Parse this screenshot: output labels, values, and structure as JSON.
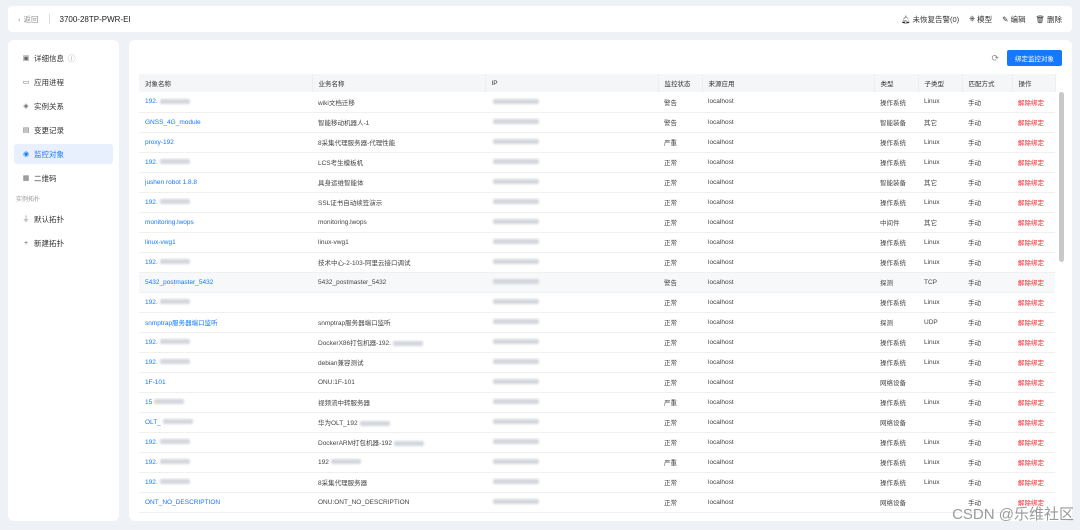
{
  "topbar": {
    "back": "返回",
    "title": "3700-28TP-PWR-EI",
    "actions": {
      "alarm": "未恢复告警(0)",
      "model": "模型",
      "edit": "编辑",
      "delete": "删除"
    }
  },
  "sidebar": {
    "items": [
      {
        "label": "详细信息",
        "icon": "info-icon"
      },
      {
        "label": "应用进程",
        "icon": "process-icon"
      },
      {
        "label": "实例关系",
        "icon": "relation-icon"
      },
      {
        "label": "变更记录",
        "icon": "record-icon"
      },
      {
        "label": "监控对象",
        "icon": "monitor-icon"
      },
      {
        "label": "二维码",
        "icon": "qrcode-icon"
      }
    ],
    "group_label": "实例拓扑",
    "topo": [
      {
        "label": "默认拓扑",
        "icon": "topology-icon"
      },
      {
        "label": "新建拓扑",
        "icon": "plus-icon"
      }
    ],
    "active_index": 4
  },
  "toolbar": {
    "bind_button": "绑定监控对象"
  },
  "table": {
    "headers": [
      "对象名称",
      "业务名称",
      "IP",
      "监控状态",
      "来源应用",
      "类型",
      "子类型",
      "匹配方式",
      "操作"
    ],
    "rows": [
      {
        "name": "192.",
        "business": "wiki文档迁移",
        "ip": "",
        "status": "警告",
        "source": "localhost",
        "type": "操作系统",
        "subtype": "Linux",
        "match": "手动",
        "op": "解除绑定"
      },
      {
        "name": "GNSS_4G_module",
        "business": "智能移动机器人-1",
        "ip": "",
        "status": "警告",
        "source": "localhost",
        "type": "智能装备",
        "subtype": "其它",
        "match": "手动",
        "op": "解除绑定"
      },
      {
        "name": "proxy-192",
        "business": "8采集代理服务器-代理性能",
        "ip": "",
        "status": "严重",
        "source": "localhost",
        "type": "操作系统",
        "subtype": "Linux",
        "match": "手动",
        "op": "解除绑定"
      },
      {
        "name": "192.",
        "business": "LCS考生模板机",
        "ip": "",
        "status": "正常",
        "source": "localhost",
        "type": "操作系统",
        "subtype": "Linux",
        "match": "手动",
        "op": "解除绑定"
      },
      {
        "name": "jushen robot 1.8.8",
        "business": "具身运维智能体",
        "ip": "",
        "status": "正常",
        "source": "localhost",
        "type": "智能装备",
        "subtype": "其它",
        "match": "手动",
        "op": "解除绑定"
      },
      {
        "name": "192.",
        "business": "SSL证书自动续签演示",
        "ip": "",
        "status": "正常",
        "source": "localhost",
        "type": "操作系统",
        "subtype": "Linux",
        "match": "手动",
        "op": "解除绑定"
      },
      {
        "name": "monitoring.lwops",
        "business": "monitoring.lwops",
        "ip": "",
        "status": "正常",
        "source": "localhost",
        "type": "中间件",
        "subtype": "其它",
        "match": "手动",
        "op": "解除绑定"
      },
      {
        "name": "linux-vwg1",
        "business": "linux-vwg1",
        "ip": "",
        "status": "正常",
        "source": "localhost",
        "type": "操作系统",
        "subtype": "Linux",
        "match": "手动",
        "op": "解除绑定"
      },
      {
        "name": "192.",
        "business": "技术中心-2-103-阿里云接口调试",
        "ip": "",
        "status": "正常",
        "source": "localhost",
        "type": "操作系统",
        "subtype": "Linux",
        "match": "手动",
        "op": "解除绑定"
      },
      {
        "name": "5432_postmaster_5432",
        "business": "5432_postmaster_5432",
        "ip": "",
        "status": "警告",
        "source": "localhost",
        "type": "探测",
        "subtype": "TCP",
        "match": "手动",
        "op": "解除绑定"
      },
      {
        "name": "192.",
        "business": "",
        "ip": "",
        "status": "正常",
        "source": "localhost",
        "type": "操作系统",
        "subtype": "Linux",
        "match": "手动",
        "op": "解除绑定"
      },
      {
        "name": "snmptrap服务器端口监听",
        "business": "snmptrap服务器端口监听",
        "ip": "",
        "status": "正常",
        "source": "localhost",
        "type": "探测",
        "subtype": "UDP",
        "match": "手动",
        "op": "解除绑定"
      },
      {
        "name": "192.",
        "business": "DockerX86打包机器-192.",
        "ip": "",
        "status": "正常",
        "source": "localhost",
        "type": "操作系统",
        "subtype": "Linux",
        "match": "手动",
        "op": "解除绑定"
      },
      {
        "name": "192.",
        "business": "debian兼容测试",
        "ip": "",
        "status": "正常",
        "source": "localhost",
        "type": "操作系统",
        "subtype": "Linux",
        "match": "手动",
        "op": "解除绑定"
      },
      {
        "name": "1F-101",
        "business": "ONU:1F-101",
        "ip": "",
        "status": "正常",
        "source": "localhost",
        "type": "网络设备",
        "subtype": "",
        "match": "手动",
        "op": "解除绑定"
      },
      {
        "name": "15",
        "business": "视频流中转服务器",
        "ip": "",
        "status": "严重",
        "source": "localhost",
        "type": "操作系统",
        "subtype": "Linux",
        "match": "手动",
        "op": "解除绑定"
      },
      {
        "name": "OLT_",
        "business": "华为OLT_192",
        "ip": "",
        "status": "正常",
        "source": "localhost",
        "type": "网络设备",
        "subtype": "",
        "match": "手动",
        "op": "解除绑定"
      },
      {
        "name": "192.",
        "business": "DockerARM打包机器-192",
        "ip": "",
        "status": "正常",
        "source": "localhost",
        "type": "操作系统",
        "subtype": "Linux",
        "match": "手动",
        "op": "解除绑定"
      },
      {
        "name": "192.",
        "business": "192",
        "ip": "",
        "status": "严重",
        "source": "localhost",
        "type": "操作系统",
        "subtype": "Linux",
        "match": "手动",
        "op": "解除绑定"
      },
      {
        "name": "192.",
        "business": "8采集代理服务器",
        "ip": "",
        "status": "正常",
        "source": "localhost",
        "type": "操作系统",
        "subtype": "Linux",
        "match": "手动",
        "op": "解除绑定"
      },
      {
        "name": "ONT_NO_DESCRIPTION",
        "business": "ONU:ONT_NO_DESCRIPTION",
        "ip": "",
        "status": "正常",
        "source": "localhost",
        "type": "网络设备",
        "subtype": "",
        "match": "手动",
        "op": "解除绑定"
      }
    ],
    "highlight_row": 9
  },
  "watermark": "CSDN @乐维社区"
}
